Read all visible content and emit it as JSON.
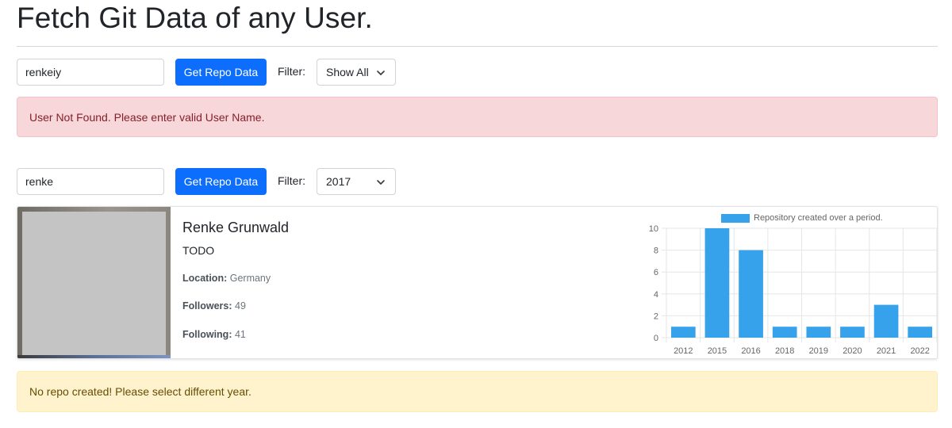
{
  "page": {
    "title": "Fetch Git Data of any User."
  },
  "search1": {
    "input_value": "renkeiy",
    "button_label": "Get Repo Data",
    "filter_label": "Filter:",
    "filter_value": "Show All",
    "alert": "User Not Found. Please enter valid User Name."
  },
  "search2": {
    "input_value": "renke",
    "button_label": "Get Repo Data",
    "filter_label": "Filter:",
    "filter_value": "2017"
  },
  "profile": {
    "name": "Renke Grunwald",
    "bio": "TODO",
    "location_label": "Location:",
    "location": "Germany",
    "followers_label": "Followers:",
    "followers": "49",
    "following_label": "Following:",
    "following": "41"
  },
  "chart_data": {
    "type": "bar",
    "legend": "Repository created over a period.",
    "legend_position": "top",
    "categories": [
      "2012",
      "2015",
      "2016",
      "2018",
      "2019",
      "2020",
      "2021",
      "2022"
    ],
    "values": [
      1,
      10,
      8,
      1,
      1,
      1,
      3,
      1
    ],
    "yticks": [
      "0",
      "2",
      "4",
      "6",
      "8",
      "10"
    ],
    "ylim": [
      0,
      10
    ],
    "grid": true,
    "color": "#36a2eb"
  },
  "alert_warning": "No repo created! Please select different year.",
  "colors": {
    "primary": "#0d6efd",
    "danger_bg": "#f8d7da",
    "danger_text": "#842029",
    "warning_bg": "#fff3cd",
    "warning_text": "#664d03",
    "bar": "#36a2eb"
  },
  "icons": {
    "select_arrow": "chevron-down-icon"
  }
}
